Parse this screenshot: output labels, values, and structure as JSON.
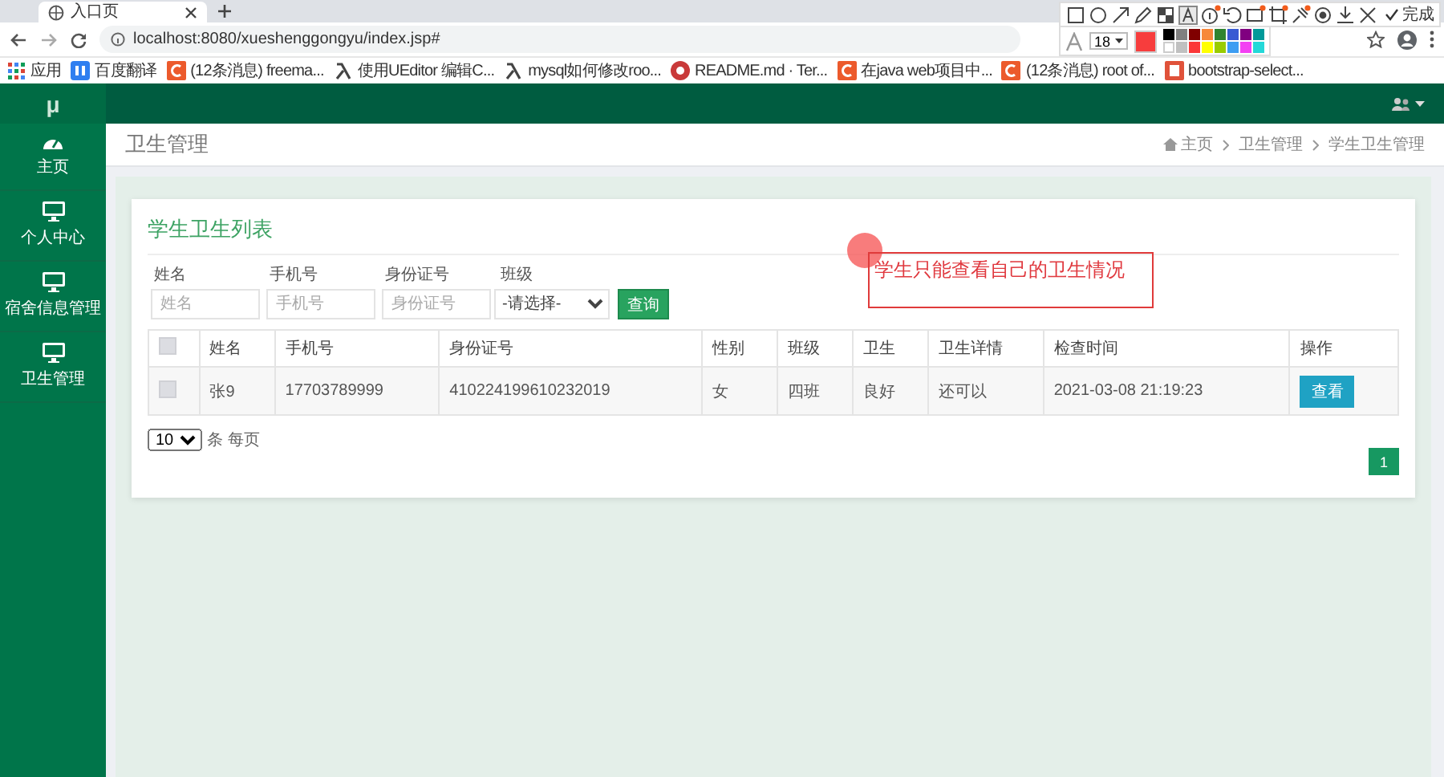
{
  "browser": {
    "tab_title": "入口页",
    "url": "localhost:8080/xueshenggongyu/index.jsp#",
    "bookmarks": [
      {
        "label": "应用",
        "kind": "apps"
      },
      {
        "label": "百度翻译",
        "kind": "blue"
      },
      {
        "label": "(12条消息) freema...",
        "kind": "csdn"
      },
      {
        "label": "使用UEditor 编辑C...",
        "kind": "lambda"
      },
      {
        "label": "mysql如何修改roo...",
        "kind": "lambda"
      },
      {
        "label": "README.md · Ter...",
        "kind": "round"
      },
      {
        "label": "在java web项目中...",
        "kind": "csdn"
      },
      {
        "label": "(12条消息) root of...",
        "kind": "csdn"
      },
      {
        "label": "bootstrap-select...",
        "kind": "book"
      }
    ]
  },
  "snip_toolbar": {
    "done": "完成",
    "font_size": "18",
    "current": {
      "color": "#f73d3d"
    },
    "swatches": [
      {
        "color": "#000000"
      },
      {
        "color": "#808080"
      },
      {
        "color": "#800000"
      },
      {
        "color": "#f7883a"
      },
      {
        "color": "#308430"
      },
      {
        "color": "#385ad3"
      },
      {
        "color": "#800080"
      },
      {
        "color": "#009999"
      },
      {
        "color": "#ffffff"
      },
      {
        "color": "#c0c0c0"
      },
      {
        "color": "#fb3838"
      },
      {
        "color": "#ffff00"
      },
      {
        "color": "#99cc00"
      },
      {
        "color": "#3d9df2"
      },
      {
        "color": "#f340f3"
      },
      {
        "color": "#23d8d8"
      }
    ]
  },
  "app": {
    "logo": "μ",
    "sidebar": [
      {
        "label": "主页",
        "kind": "dashboard"
      },
      {
        "label": "个人中心",
        "kind": "monitor"
      },
      {
        "label": "宿舍信息管理",
        "kind": "monitor"
      },
      {
        "label": "卫生管理",
        "kind": "monitor"
      }
    ],
    "page_title": "卫生管理",
    "breadcrumb": [
      "主页",
      "卫生管理",
      "学生卫生管理"
    ]
  },
  "card": {
    "title": "学生卫生列表",
    "filters": [
      {
        "label": "姓名",
        "kind": "text",
        "placeholder": "姓名"
      },
      {
        "label": "手机号",
        "kind": "text",
        "placeholder": "手机号"
      },
      {
        "label": "身份证号",
        "kind": "text",
        "placeholder": "身份证号"
      },
      {
        "label": "班级",
        "kind": "select",
        "value": "-请选择-"
      }
    ],
    "search_button": "查询",
    "table": {
      "select_all": {
        "checked": false
      },
      "columns": [
        "姓名",
        "手机号",
        "身份证号",
        "性别",
        "班级",
        "卫生",
        "卫生详情",
        "检查时间",
        "操作"
      ],
      "rows": [
        {
          "checked": false,
          "cells": [
            "张9",
            "17703789999",
            "410224199610232019",
            "女",
            "四班",
            "良好",
            "还可以",
            "2021-03-08 21:19:23"
          ],
          "action": "查看"
        }
      ]
    },
    "page_size": "10",
    "page_size_suffix": "条 每页",
    "pages": [
      {
        "label": "1",
        "selected": true
      }
    ]
  },
  "annotation": {
    "text": "学生只能查看自己的卫生情况"
  }
}
